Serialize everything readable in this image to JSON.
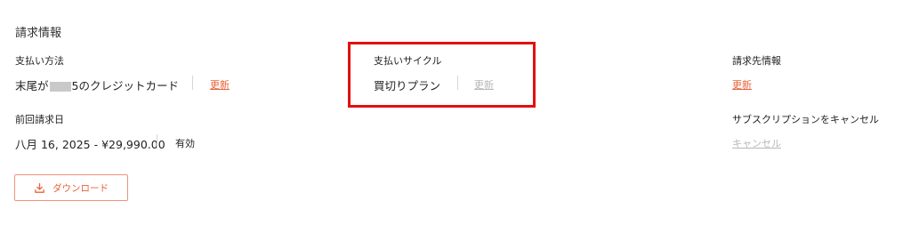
{
  "billing": {
    "title": "請求情報",
    "payment_method": {
      "label": "支払い方法",
      "value_prefix": "末尾が",
      "value_suffix": "5のクレジットカード",
      "update_link": "更新"
    },
    "payment_cycle": {
      "label": "支払いサイクル",
      "value": "買切りプラン",
      "update_link": "更新"
    },
    "billing_address": {
      "label": "請求先情報",
      "update_link": "更新"
    },
    "last_billing": {
      "label": "前回請求日",
      "value": "八月 16, 2025 - ¥29,990.00",
      "status": "有効"
    },
    "cancel_subscription": {
      "label": "サブスクリプションをキャンセル",
      "link": "キャンセル"
    },
    "download_button": {
      "label": "ダウンロード",
      "icon": "download-icon"
    }
  },
  "colors": {
    "accent": "#e8633a",
    "highlight_border": "#e3100e",
    "disabled": "#b8b8b8"
  }
}
